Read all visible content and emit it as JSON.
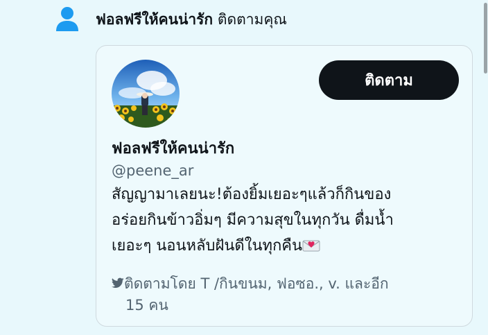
{
  "notification": {
    "icon": "person-icon",
    "name": "ฟอลฟรีให้คนน่ารัก",
    "action": " ติดตามคุณ"
  },
  "card": {
    "follow_button": "ติดตาม",
    "display_name": "ฟอลฟรีให้คนน่ารัก",
    "handle": "@peene_ar",
    "bio_lines": [
      "สัญญามาเลยนะ!ต้องยิ้มเยอะๆแล้วก็กินของ",
      "อร่อยกินข้าวอิ่มๆ มีความสุขในทุกวัน ดื่มน้ำ",
      "เยอะๆ นอนหลับฝันดีในทุกคืน"
    ],
    "bio_emoji": "love-letter-icon",
    "followed_by_lines": [
      "ติดตามโดย T /กินขนม, ฟอซอ., v. และอีก",
      "15 คน"
    ],
    "followed_by_icon": "bird-icon"
  },
  "colors": {
    "background": "#e8f8fc",
    "button": "#0f1419",
    "accent_icon": "#1d9bf0",
    "muted_text": "#536471"
  }
}
